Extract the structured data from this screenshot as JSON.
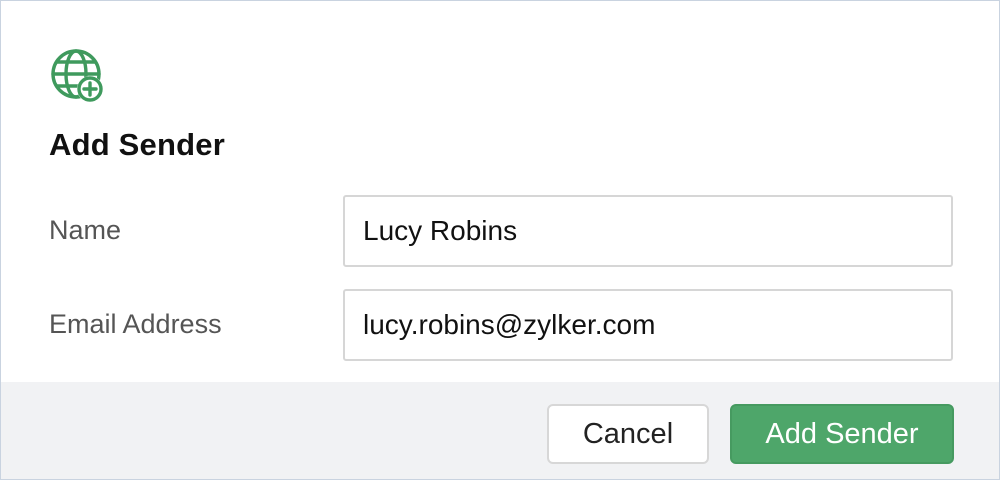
{
  "dialog": {
    "title": "Add Sender",
    "icon": "globe-add-icon",
    "accent_color": "#3f9a5d"
  },
  "form": {
    "name_label": "Name",
    "name_value": "Lucy Robins",
    "email_label": "Email Address",
    "email_value": "lucy.robins@zylker.com"
  },
  "footer": {
    "cancel_label": "Cancel",
    "submit_label": "Add Sender",
    "submit_color": "#4ea66a"
  }
}
